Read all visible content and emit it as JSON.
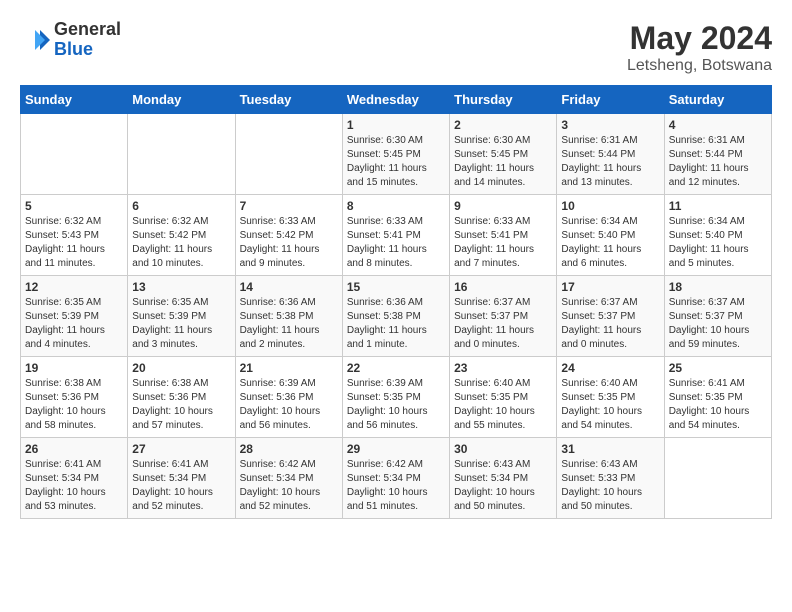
{
  "header": {
    "logo_general": "General",
    "logo_blue": "Blue",
    "month_title": "May 2024",
    "location": "Letsheng, Botswana"
  },
  "weekdays": [
    "Sunday",
    "Monday",
    "Tuesday",
    "Wednesday",
    "Thursday",
    "Friday",
    "Saturday"
  ],
  "rows": [
    [
      {
        "day": "",
        "info": ""
      },
      {
        "day": "",
        "info": ""
      },
      {
        "day": "",
        "info": ""
      },
      {
        "day": "1",
        "info": "Sunrise: 6:30 AM\nSunset: 5:45 PM\nDaylight: 11 hours\nand 15 minutes."
      },
      {
        "day": "2",
        "info": "Sunrise: 6:30 AM\nSunset: 5:45 PM\nDaylight: 11 hours\nand 14 minutes."
      },
      {
        "day": "3",
        "info": "Sunrise: 6:31 AM\nSunset: 5:44 PM\nDaylight: 11 hours\nand 13 minutes."
      },
      {
        "day": "4",
        "info": "Sunrise: 6:31 AM\nSunset: 5:44 PM\nDaylight: 11 hours\nand 12 minutes."
      }
    ],
    [
      {
        "day": "5",
        "info": "Sunrise: 6:32 AM\nSunset: 5:43 PM\nDaylight: 11 hours\nand 11 minutes."
      },
      {
        "day": "6",
        "info": "Sunrise: 6:32 AM\nSunset: 5:42 PM\nDaylight: 11 hours\nand 10 minutes."
      },
      {
        "day": "7",
        "info": "Sunrise: 6:33 AM\nSunset: 5:42 PM\nDaylight: 11 hours\nand 9 minutes."
      },
      {
        "day": "8",
        "info": "Sunrise: 6:33 AM\nSunset: 5:41 PM\nDaylight: 11 hours\nand 8 minutes."
      },
      {
        "day": "9",
        "info": "Sunrise: 6:33 AM\nSunset: 5:41 PM\nDaylight: 11 hours\nand 7 minutes."
      },
      {
        "day": "10",
        "info": "Sunrise: 6:34 AM\nSunset: 5:40 PM\nDaylight: 11 hours\nand 6 minutes."
      },
      {
        "day": "11",
        "info": "Sunrise: 6:34 AM\nSunset: 5:40 PM\nDaylight: 11 hours\nand 5 minutes."
      }
    ],
    [
      {
        "day": "12",
        "info": "Sunrise: 6:35 AM\nSunset: 5:39 PM\nDaylight: 11 hours\nand 4 minutes."
      },
      {
        "day": "13",
        "info": "Sunrise: 6:35 AM\nSunset: 5:39 PM\nDaylight: 11 hours\nand 3 minutes."
      },
      {
        "day": "14",
        "info": "Sunrise: 6:36 AM\nSunset: 5:38 PM\nDaylight: 11 hours\nand 2 minutes."
      },
      {
        "day": "15",
        "info": "Sunrise: 6:36 AM\nSunset: 5:38 PM\nDaylight: 11 hours\nand 1 minute."
      },
      {
        "day": "16",
        "info": "Sunrise: 6:37 AM\nSunset: 5:37 PM\nDaylight: 11 hours\nand 0 minutes."
      },
      {
        "day": "17",
        "info": "Sunrise: 6:37 AM\nSunset: 5:37 PM\nDaylight: 11 hours\nand 0 minutes."
      },
      {
        "day": "18",
        "info": "Sunrise: 6:37 AM\nSunset: 5:37 PM\nDaylight: 10 hours\nand 59 minutes."
      }
    ],
    [
      {
        "day": "19",
        "info": "Sunrise: 6:38 AM\nSunset: 5:36 PM\nDaylight: 10 hours\nand 58 minutes."
      },
      {
        "day": "20",
        "info": "Sunrise: 6:38 AM\nSunset: 5:36 PM\nDaylight: 10 hours\nand 57 minutes."
      },
      {
        "day": "21",
        "info": "Sunrise: 6:39 AM\nSunset: 5:36 PM\nDaylight: 10 hours\nand 56 minutes."
      },
      {
        "day": "22",
        "info": "Sunrise: 6:39 AM\nSunset: 5:35 PM\nDaylight: 10 hours\nand 56 minutes."
      },
      {
        "day": "23",
        "info": "Sunrise: 6:40 AM\nSunset: 5:35 PM\nDaylight: 10 hours\nand 55 minutes."
      },
      {
        "day": "24",
        "info": "Sunrise: 6:40 AM\nSunset: 5:35 PM\nDaylight: 10 hours\nand 54 minutes."
      },
      {
        "day": "25",
        "info": "Sunrise: 6:41 AM\nSunset: 5:35 PM\nDaylight: 10 hours\nand 54 minutes."
      }
    ],
    [
      {
        "day": "26",
        "info": "Sunrise: 6:41 AM\nSunset: 5:34 PM\nDaylight: 10 hours\nand 53 minutes."
      },
      {
        "day": "27",
        "info": "Sunrise: 6:41 AM\nSunset: 5:34 PM\nDaylight: 10 hours\nand 52 minutes."
      },
      {
        "day": "28",
        "info": "Sunrise: 6:42 AM\nSunset: 5:34 PM\nDaylight: 10 hours\nand 52 minutes."
      },
      {
        "day": "29",
        "info": "Sunrise: 6:42 AM\nSunset: 5:34 PM\nDaylight: 10 hours\nand 51 minutes."
      },
      {
        "day": "30",
        "info": "Sunrise: 6:43 AM\nSunset: 5:34 PM\nDaylight: 10 hours\nand 50 minutes."
      },
      {
        "day": "31",
        "info": "Sunrise: 6:43 AM\nSunset: 5:33 PM\nDaylight: 10 hours\nand 50 minutes."
      },
      {
        "day": "",
        "info": ""
      }
    ]
  ]
}
